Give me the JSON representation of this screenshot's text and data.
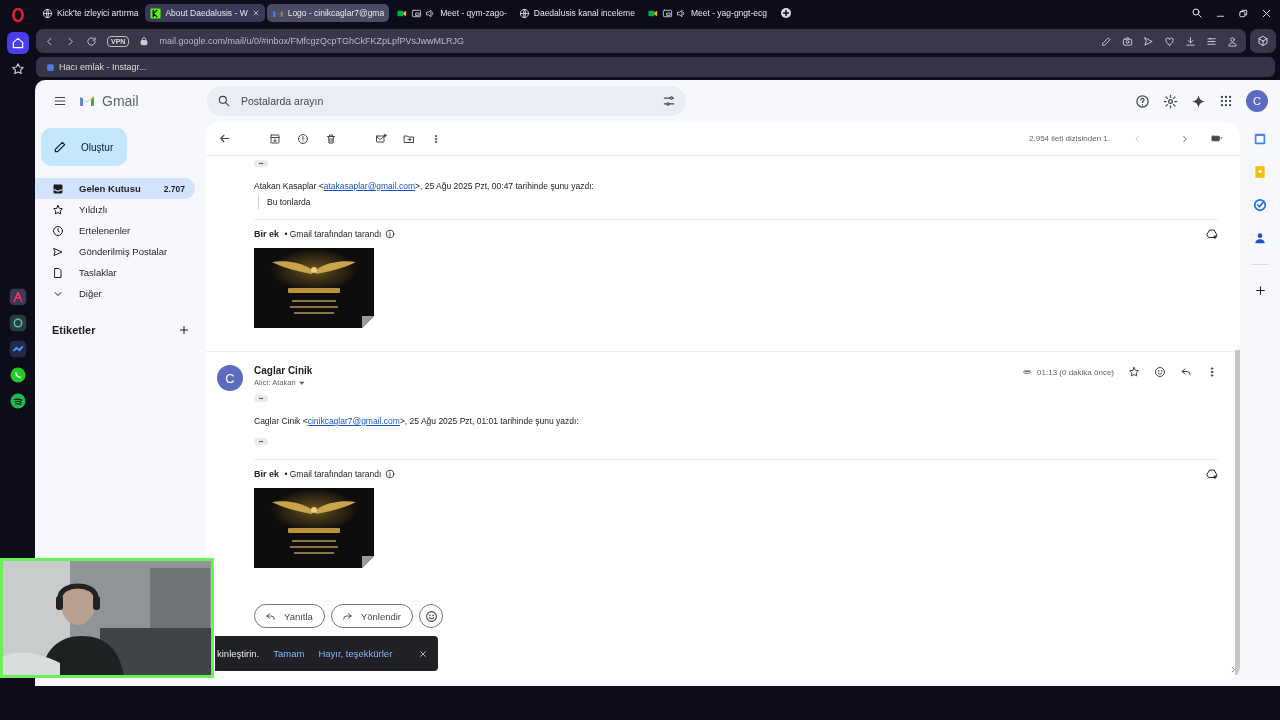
{
  "browser": {
    "tabs": [
      {
        "label": "Kick'te izleyici artırma",
        "selected": false,
        "hovered": false,
        "kind": "site"
      },
      {
        "label": "About Daedalusis - W",
        "selected": false,
        "hovered": true,
        "kind": "kick"
      },
      {
        "label": "Logo - cinikcaglar7@gma",
        "selected": true,
        "hovered": false,
        "kind": "gmail"
      },
      {
        "label": "Meet - qym-zago-",
        "selected": false,
        "hovered": false,
        "kind": "meet"
      },
      {
        "label": "Daedalusis kanal inceleme",
        "selected": false,
        "hovered": false,
        "kind": "site"
      },
      {
        "label": "Meet - yag-gngt-ecg",
        "selected": false,
        "hovered": false,
        "kind": "meet"
      }
    ],
    "vpn": "VPN",
    "url": "mail.google.com/mail/u/0/#inbox/FMfcgzQcpTGhCkFKZpLpfPVsJwwMLRJG",
    "bookmarks": [
      {
        "label": "Hacı emlak - Instagr..."
      }
    ]
  },
  "gmail": {
    "product": "Gmail",
    "search_placeholder": "Postalarda arayın",
    "account_initial": "C",
    "compose": "Oluştur",
    "nav": [
      {
        "label": "Gelen Kutusu",
        "count": "2.707",
        "selected": true
      },
      {
        "label": "Yıldızlı",
        "selected": false
      },
      {
        "label": "Ertelenenler",
        "selected": false
      },
      {
        "label": "Gönderilmiş Postalar",
        "selected": false
      },
      {
        "label": "Taslaklar",
        "selected": false
      },
      {
        "label": "Diğer",
        "selected": false
      }
    ],
    "labels_heading": "Etiketler",
    "pagination": "2.954 ileti dizisinden 1.",
    "messages": [
      {
        "kind": "continued",
        "quote": {
          "before": "Atakan Kasaplar <",
          "link": "atakasaplar@gmail.com",
          "after": ">, 25 Ağu 2025 Pzt, 00:47 tarihinde şunu yazdı:"
        },
        "quoted_text": "Bu tonlarda",
        "attachment_note": "**Bir ek** • Gmail tarafından tarandı"
      },
      {
        "kind": "full",
        "avatar_initial": "C",
        "sender": "Caglar Cinik",
        "recipient": "Alıcı: Atakan",
        "time": "01:13 (0 dakika önce)",
        "quote": {
          "before": "Caglar Cinik <",
          "link": "cinikcaglar7@gmail.com",
          "after": ">, 25 Ağu 2025 Pzt, 01:01 tarihinde şunu yazdı:"
        },
        "attachment_note": "**Bir ek** • Gmail tarafından tarandı"
      }
    ],
    "reply_buttons": [
      {
        "label": "Yanıtla",
        "kind": "reply"
      },
      {
        "label": "Yönlendir",
        "kind": "forward"
      }
    ],
    "toast": {
      "text": "kinleştirin.",
      "actions": [
        "Tamam",
        "Hayır, teşekkürler"
      ]
    }
  }
}
